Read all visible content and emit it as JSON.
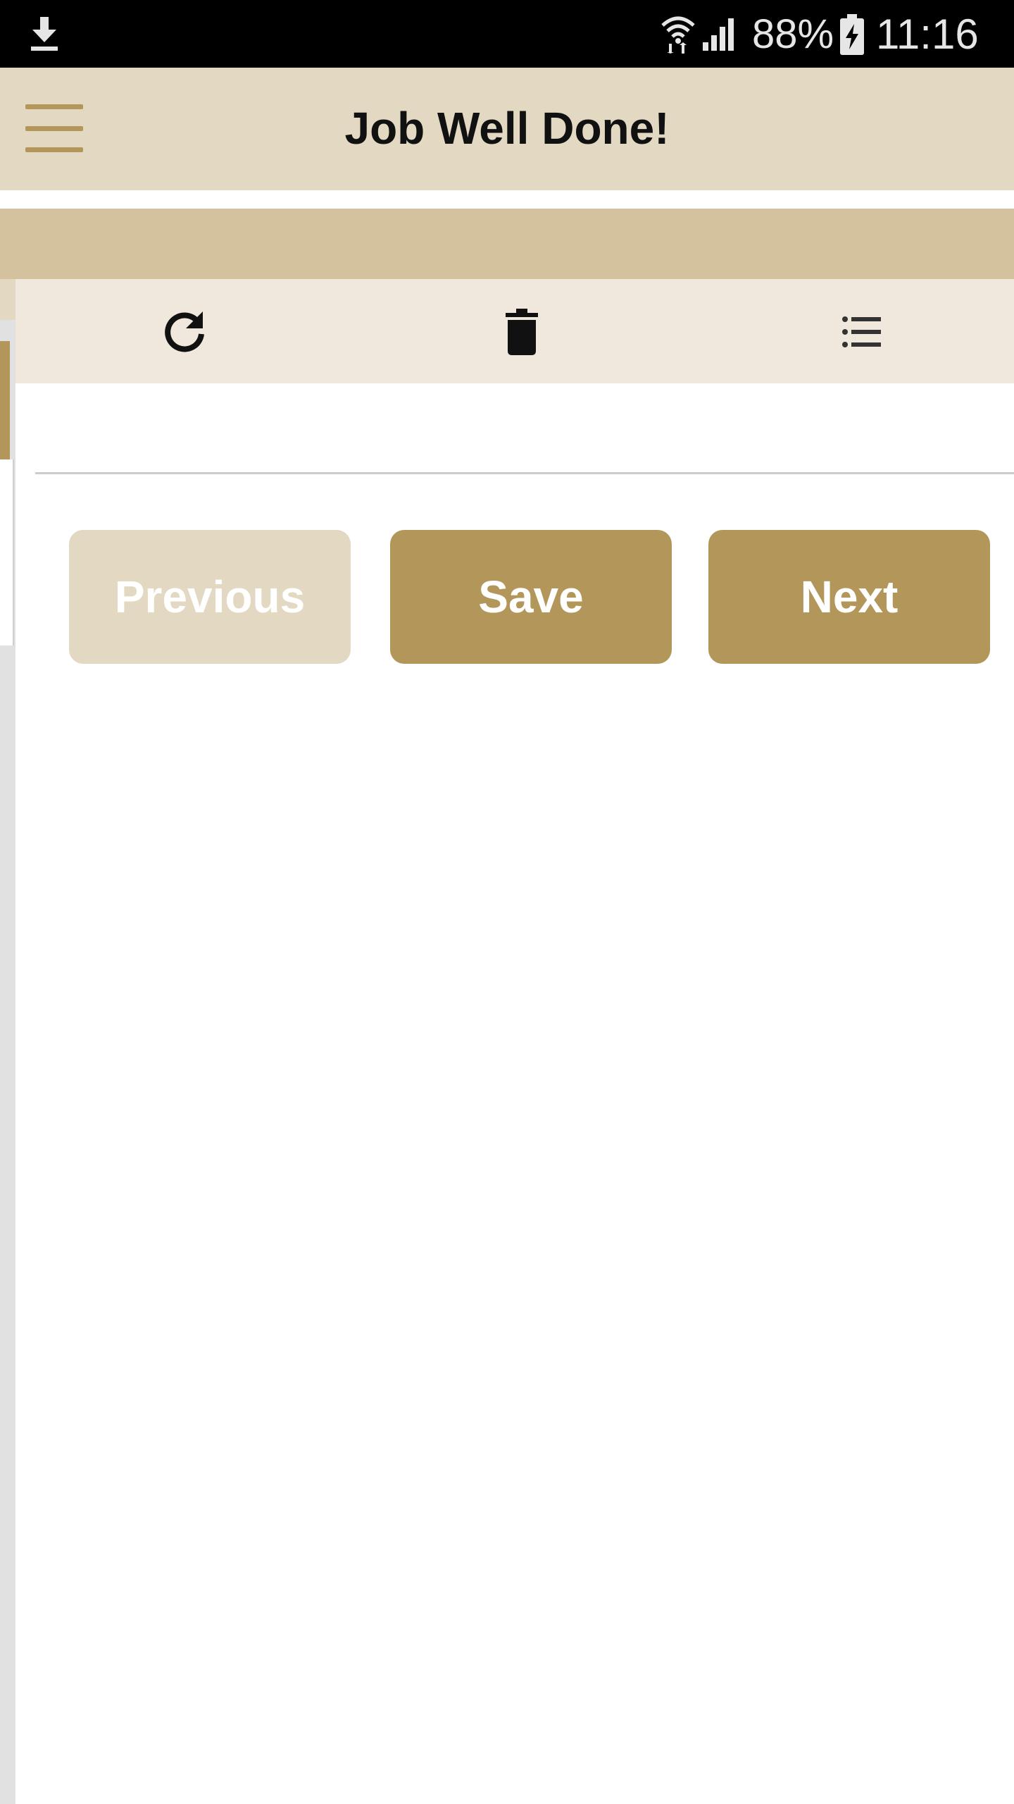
{
  "status_bar": {
    "battery_percent": "88%",
    "time": "11:16",
    "icons": [
      "download-icon",
      "wifi-icon",
      "cell-signal-icon",
      "battery-charging-icon"
    ]
  },
  "app_bar": {
    "title": "Job Well Done!",
    "menu_icon": "hamburger-menu-icon"
  },
  "toolbar": {
    "items": [
      {
        "icon": "refresh-icon"
      },
      {
        "icon": "trash-icon"
      },
      {
        "icon": "list-icon"
      }
    ]
  },
  "form": {
    "field_value": "",
    "placeholder": ""
  },
  "nav_buttons": {
    "previous_label": "Previous",
    "save_label": "Save",
    "next_label": "Next",
    "previous_enabled": false
  },
  "colors": {
    "accent": "#b3975a",
    "app_bar_bg": "#e3d8c1",
    "panel_header_bg": "#d4c29e",
    "toolbar_bg": "#f0e8dc",
    "disabled_button": "#e3d8c1"
  }
}
